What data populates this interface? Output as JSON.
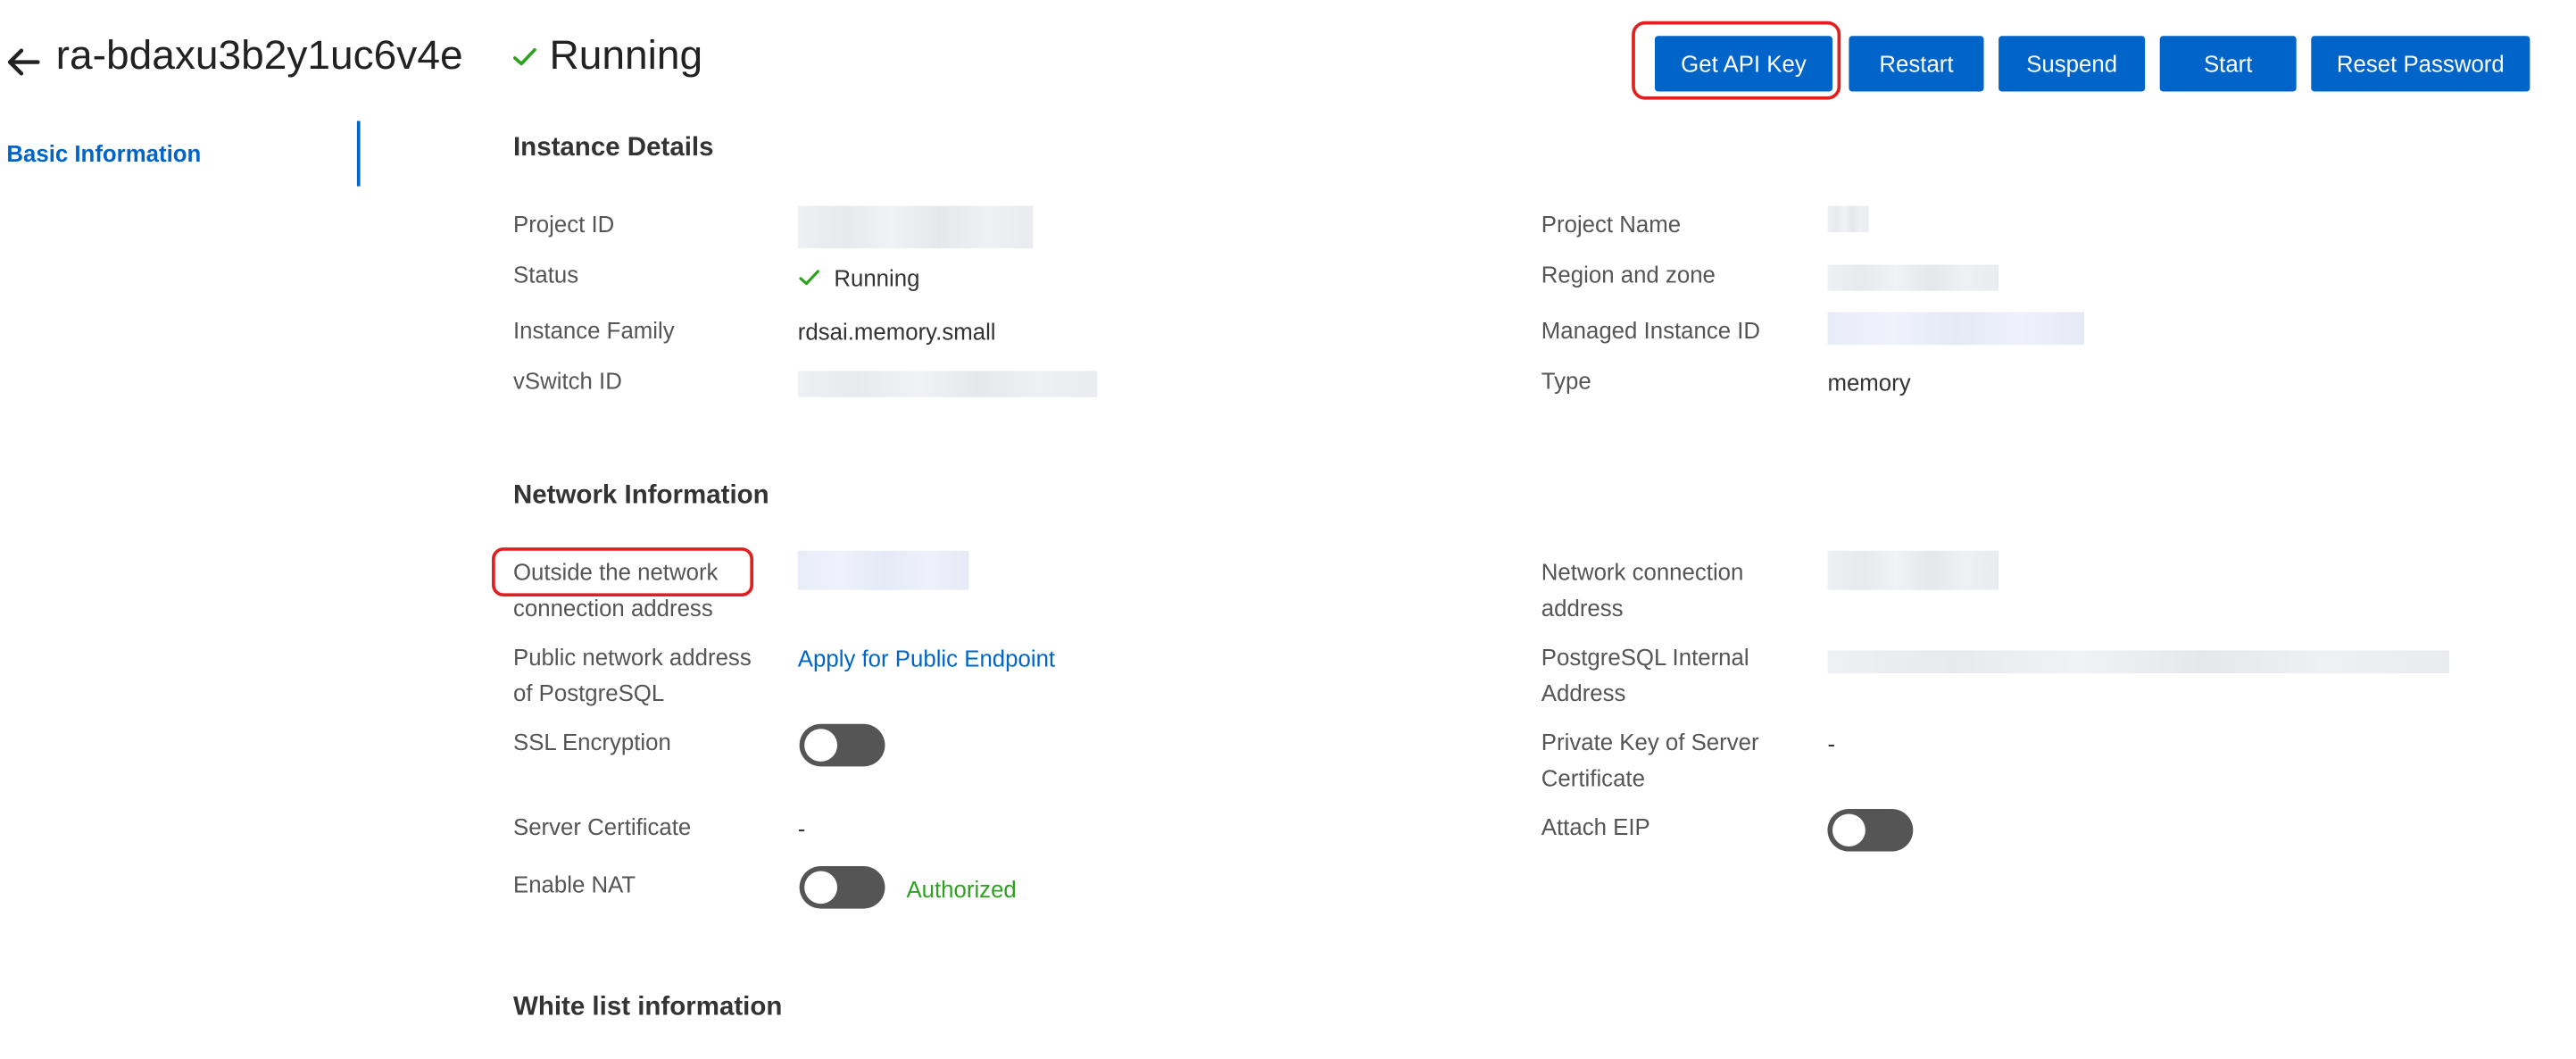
{
  "header": {
    "instance_name": "ra-bdaxu3b2y1uc6v4e",
    "status": "Running",
    "buttons": {
      "get_api_key": "Get API Key",
      "restart": "Restart",
      "suspend": "Suspend",
      "start": "Start",
      "reset_password": "Reset Password"
    }
  },
  "nav": {
    "basic_information": "Basic Information"
  },
  "instance_details": {
    "title": "Instance Details",
    "project_id": {
      "label": "Project ID"
    },
    "project_name": {
      "label": "Project Name"
    },
    "status": {
      "label": "Status",
      "value": "Running"
    },
    "region_zone": {
      "label": "Region and zone"
    },
    "instance_family": {
      "label": "Instance Family",
      "value": "rdsai.memory.small"
    },
    "managed_instance_id": {
      "label": "Managed Instance ID"
    },
    "vswitch_id": {
      "label": "vSwitch ID"
    },
    "type": {
      "label": "Type",
      "value": "memory"
    }
  },
  "network_information": {
    "title": "Network Information",
    "outside_address": {
      "label_line1": "Outside the network",
      "label_line2": "connection address"
    },
    "network_connection_address": {
      "label_line1": "Network connection",
      "label_line2": "address"
    },
    "public_address_pg": {
      "label_line1": "Public network address",
      "label_line2": "of PostgreSQL",
      "link": "Apply for Public Endpoint"
    },
    "pg_internal_address": {
      "label_line1": "PostgreSQL Internal",
      "label_line2": "Address"
    },
    "ssl_encryption": {
      "label": "SSL Encryption",
      "enabled": false
    },
    "private_key": {
      "label_line1": "Private Key of Server",
      "label_line2": "Certificate",
      "value": "-"
    },
    "server_certificate": {
      "label": "Server Certificate",
      "value": "-"
    },
    "attach_eip": {
      "label": "Attach EIP",
      "enabled": false
    },
    "enable_nat": {
      "label": "Enable NAT",
      "enabled": false,
      "status": "Authorized"
    }
  },
  "white_list": {
    "title": "White list information"
  },
  "colors": {
    "primary": "#0064c8",
    "highlight": "#e02020",
    "success": "#2ea121",
    "toggle_off": "#555555"
  }
}
